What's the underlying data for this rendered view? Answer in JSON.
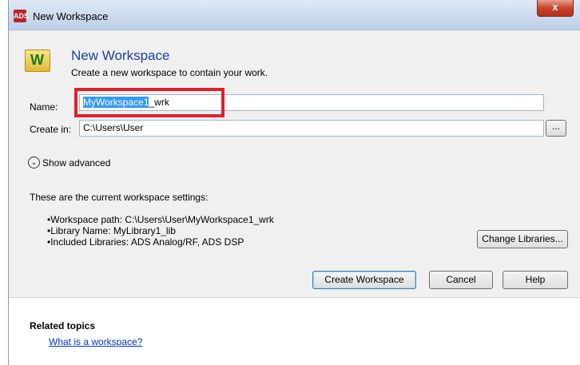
{
  "window": {
    "title": "New Workspace",
    "app_icon": "ads-app-icon",
    "close_label": "x"
  },
  "header": {
    "title": "New Workspace",
    "subtitle": "Create a new workspace to contain your work.",
    "icon_letter": "W"
  },
  "form": {
    "name_label": "Name:",
    "name_selected": "MyWorkspace1",
    "name_rest": "_wrk",
    "create_in_label": "Create in:",
    "create_in_value": "C:\\Users\\User",
    "browse_label": "..."
  },
  "advanced": {
    "label": "Show advanced"
  },
  "settings": {
    "intro": "These are the current workspace settings:",
    "items": [
      "Workspace path:  C:\\Users\\User\\MyWorkspace1_wrk",
      "Library Name:  MyLibrary1_lib",
      "Included Libraries:  ADS Analog/RF, ADS DSP"
    ],
    "change_libraries_label": "Change Libraries..."
  },
  "buttons": {
    "create": "Create Workspace",
    "cancel": "Cancel",
    "help": "Help"
  },
  "related": {
    "title": "Related topics",
    "link": "What is a workspace?"
  }
}
